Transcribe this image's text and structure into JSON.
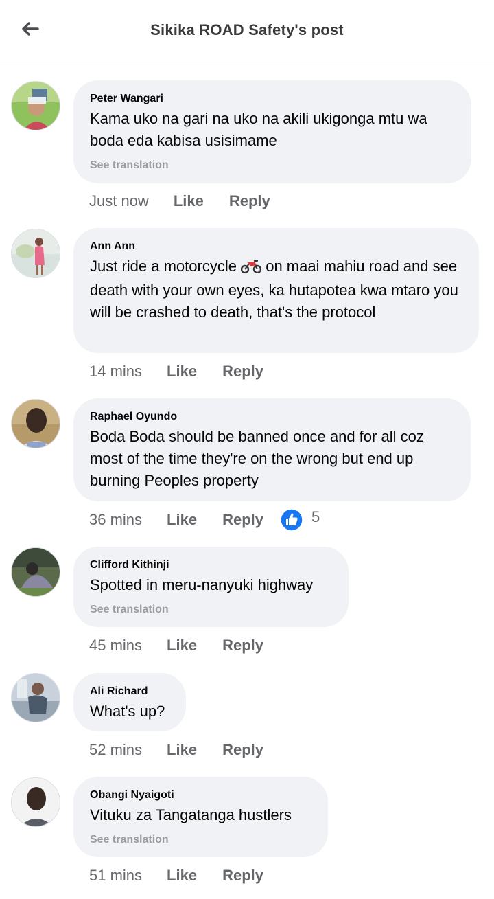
{
  "header": {
    "title": "Sikika ROAD Safety's post"
  },
  "labels": {
    "like": "Like",
    "reply": "Reply",
    "see_translation": "See translation"
  },
  "comments": [
    {
      "author": "Peter Wangari",
      "text": "Kama uko na gari na uko na akili ukigonga mtu wa boda eda kabisa usisimame",
      "time": "Just now",
      "avatar_icon": "user-avatar"
    },
    {
      "author": "Ann Ann",
      "text_before": "Just ride a motorcycle",
      "text_after": "on maai mahiu road and see death with your own eyes, ka hutapotea kwa mtaro you will be crashed to death, that's the protocol",
      "emoji_icon": "motorcycle-emoji-icon",
      "time": "14 mins",
      "avatar_icon": "user-avatar"
    },
    {
      "author": "Raphael Oyundo",
      "text": "Boda Boda should be banned once and for all coz most of the time they're on the wrong but end up burning Peoples property",
      "time": "36 mins",
      "reaction_icon": "thumbs-up-icon",
      "reaction_count": "5",
      "reaction_color": "#1877f2",
      "avatar_icon": "user-avatar"
    },
    {
      "author": "Clifford Kithinji",
      "text": "Spotted in meru-nanyuki highway",
      "time": "45 mins",
      "avatar_icon": "user-avatar"
    },
    {
      "author": "Ali Richard",
      "text": "What's up?",
      "time": "52 mins",
      "avatar_icon": "user-avatar"
    },
    {
      "author": "Obangi Nyaigoti",
      "text": "Vituku za Tangatanga hustlers",
      "time": "51 mins",
      "avatar_icon": "user-avatar"
    }
  ]
}
